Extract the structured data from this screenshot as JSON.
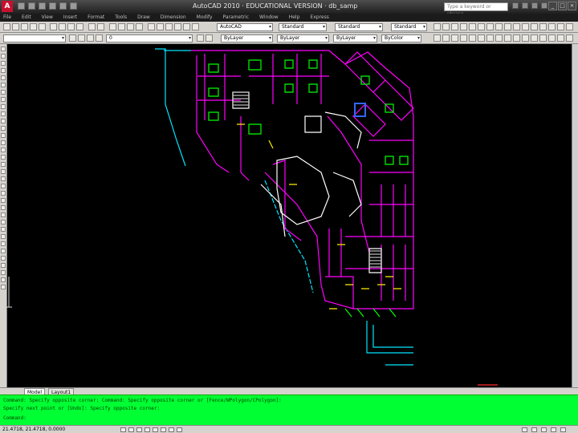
{
  "titlebar": {
    "logo": "A",
    "title": "AutoCAD 2010 · EDUCATIONAL VERSION · db_samp",
    "search_placeholder": "Type a keyword or phrase"
  },
  "menu": [
    "File",
    "Edit",
    "View",
    "Insert",
    "Format",
    "Tools",
    "Draw",
    "Dimension",
    "Modify",
    "Parametric",
    "Window",
    "Help",
    "Express"
  ],
  "toolbar": {
    "workspace": "AutoCAD",
    "layer_value": "0",
    "layer_state": "",
    "linetype": "ByLayer",
    "lineweight": "ByLayer",
    "plotstyle": "ByColor",
    "color": "ByLayer",
    "textstyle": "Standard",
    "dimstyle": "Standard",
    "tablestyle": "Standard",
    "mleaderstyle": "Standard"
  },
  "tabs": [
    "Model",
    "Layout1"
  ],
  "command_lines": [
    "Command: Specify opposite corner: Command: Specify opposite corner or [Fence/WPolygon/CPolygon]:",
    "Specify next point or [Undo]: Specify opposite corner:",
    "Command:"
  ],
  "status": {
    "coordinates": "21.4718, 21.4718, 0.0000"
  },
  "colors": {
    "command_bg": "#00ff33",
    "canvas_bg": "#000000",
    "magenta": "#ff00ff",
    "cyan": "#00e5ff",
    "yellow": "#ffee00",
    "green": "#00ff00",
    "white": "#ffffff"
  }
}
